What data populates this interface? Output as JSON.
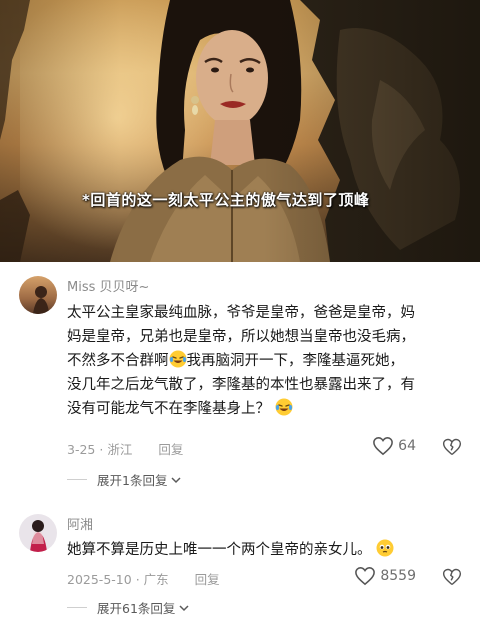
{
  "video": {
    "subtitle": "*回首的这一刻太平公主的傲气达到了顶峰"
  },
  "comments": [
    {
      "username": "Miss 贝贝呀~",
      "lines": [
        "太平公主皇家最纯血脉，爷爷是皇帝，爸爸是皇帝，妈",
        "妈是皇帝，兄弟也是皇帝，所以她想当皇帝也没毛病，",
        "不然多不合群啊",
        "我再脑洞开一下，李隆基逼死她，",
        "没几年之后龙气散了，李隆基的本性也暴露出来了，有",
        "没有可能龙气不在李隆基身上？"
      ],
      "date": "3-25",
      "location": "浙江",
      "reply_label": "回复",
      "likes": "64",
      "expand_label": "展开1条回复"
    },
    {
      "username": "阿湘",
      "lines": [
        "她算不算是历史上唯一一个两个皇帝的亲女儿。"
      ],
      "date": "2025-5-10",
      "location": "广东",
      "reply_label": "回复",
      "likes": "8559",
      "expand_label": "展开61条回复"
    }
  ],
  "colors": {
    "username": "#8b8b8b",
    "text": "#1a1a1a",
    "meta": "#9b9b9b"
  },
  "icons": [
    "heart-icon",
    "broken-heart-icon",
    "chevron-down-icon",
    "laughing-crying-emoji",
    "teary-emoji"
  ]
}
